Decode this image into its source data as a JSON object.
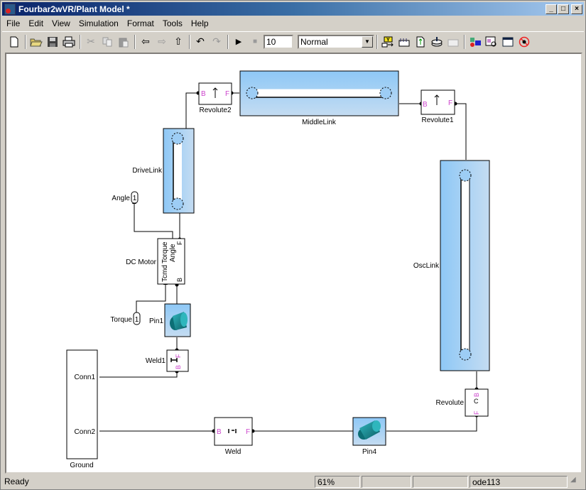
{
  "window": {
    "title": "Fourbar2wVR/Plant  Model *",
    "buttons": {
      "minimize": "_",
      "maximize": "□",
      "close": "×"
    }
  },
  "menubar": {
    "items": [
      "File",
      "Edit",
      "View",
      "Simulation",
      "Format",
      "Tools",
      "Help"
    ]
  },
  "toolbar": {
    "stop_time": "10",
    "sim_mode": "Normal",
    "icons": {
      "new": "new-model-icon",
      "open": "open-icon",
      "save": "save-icon",
      "print": "print-icon",
      "cut": "cut-icon",
      "copy": "copy-icon",
      "paste": "paste-icon",
      "back": "back-arrow-icon",
      "forward": "forward-arrow-icon",
      "up": "up-arrow-icon",
      "undo": "undo-icon",
      "redo": "redo-icon",
      "start": "start-simulation-icon",
      "stop": "stop-simulation-icon",
      "build": "build-icon",
      "update": "update-diagram-icon",
      "refresh": "refresh-icon",
      "library": "library-browser-icon",
      "debug": "debugger-icon",
      "model_explorer": "model-explorer-icon",
      "advisor": "model-advisor-icon",
      "properties": "properties-icon",
      "no_bugs": "no-debug-icon"
    }
  },
  "diagram": {
    "blocks": {
      "revolute2": {
        "label": "Revolute2",
        "port_b": "B",
        "port_f": "F"
      },
      "middle_link": {
        "label": "MiddleLink"
      },
      "revolute1": {
        "label": "Revolute1",
        "port_b": "B",
        "port_f": "F"
      },
      "drive_link": {
        "label": "DriveLink"
      },
      "osc_link": {
        "label": "OscLink"
      },
      "angle_out": {
        "label": "Angle",
        "port_number": "1"
      },
      "dc_motor": {
        "label": "DC Motor",
        "port_tcmd": "Tcmd",
        "port_torque": "Torque",
        "port_angle": "Angle",
        "port_f": "F",
        "port_b": "B"
      },
      "torque_in": {
        "label": "Torque",
        "port_number": "1"
      },
      "pin1": {
        "label": "Pin1"
      },
      "weld1": {
        "label": "Weld1",
        "port_b": "B",
        "port_f": "F"
      },
      "ground": {
        "label": "Ground",
        "conn1": "Conn1",
        "conn2": "Conn2"
      },
      "weld": {
        "label": "Weld",
        "port_b": "B",
        "port_f": "F"
      },
      "pin4": {
        "label": "Pin4"
      },
      "revolute": {
        "label": "Revolute",
        "port_b": "B",
        "port_f": "F",
        "port_c": "C"
      }
    },
    "colors": {
      "port_label": "#cc44cc",
      "body_fill_start": "#8ec8f6",
      "body_fill_end": "#c4dcf2",
      "cylinder": "#1b8d95"
    }
  },
  "statusbar": {
    "status": "Ready",
    "zoom": "61%",
    "cell3": "",
    "cell4": "",
    "solver": "ode113"
  }
}
